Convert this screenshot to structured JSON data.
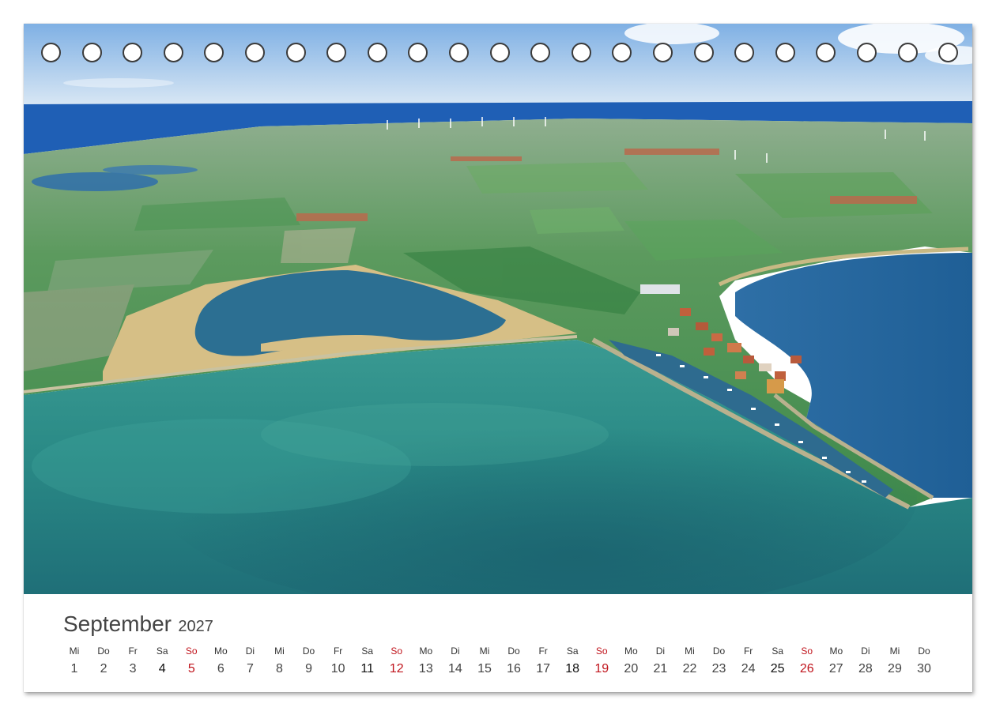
{
  "calendar": {
    "month": "September",
    "year": "2027",
    "days": [
      {
        "weekday": "Mi",
        "day": "1"
      },
      {
        "weekday": "Do",
        "day": "2"
      },
      {
        "weekday": "Fr",
        "day": "3"
      },
      {
        "weekday": "Sa",
        "day": "4"
      },
      {
        "weekday": "So",
        "day": "5"
      },
      {
        "weekday": "Mo",
        "day": "6"
      },
      {
        "weekday": "Di",
        "day": "7"
      },
      {
        "weekday": "Mi",
        "day": "8"
      },
      {
        "weekday": "Do",
        "day": "9"
      },
      {
        "weekday": "Fr",
        "day": "10"
      },
      {
        "weekday": "Sa",
        "day": "11"
      },
      {
        "weekday": "So",
        "day": "12"
      },
      {
        "weekday": "Mo",
        "day": "13"
      },
      {
        "weekday": "Di",
        "day": "14"
      },
      {
        "weekday": "Mi",
        "day": "15"
      },
      {
        "weekday": "Do",
        "day": "16"
      },
      {
        "weekday": "Fr",
        "day": "17"
      },
      {
        "weekday": "Sa",
        "day": "18"
      },
      {
        "weekday": "So",
        "day": "19"
      },
      {
        "weekday": "Mo",
        "day": "20"
      },
      {
        "weekday": "Di",
        "day": "21"
      },
      {
        "weekday": "Mi",
        "day": "22"
      },
      {
        "weekday": "Do",
        "day": "23"
      },
      {
        "weekday": "Fr",
        "day": "24"
      },
      {
        "weekday": "Sa",
        "day": "25"
      },
      {
        "weekday": "So",
        "day": "26"
      },
      {
        "weekday": "Mo",
        "day": "27"
      },
      {
        "weekday": "Di",
        "day": "28"
      },
      {
        "weekday": "Mi",
        "day": "29"
      },
      {
        "weekday": "Do",
        "day": "30"
      }
    ]
  },
  "binding": {
    "ring_count": 23
  },
  "colors": {
    "sunday": "#c0141c",
    "sky": "#a9c8ea",
    "sea_shallow": "#2a8f8a",
    "sea_deep": "#1c6a8c",
    "fields": "#4f8f55",
    "reeds": "#d6bf86"
  }
}
